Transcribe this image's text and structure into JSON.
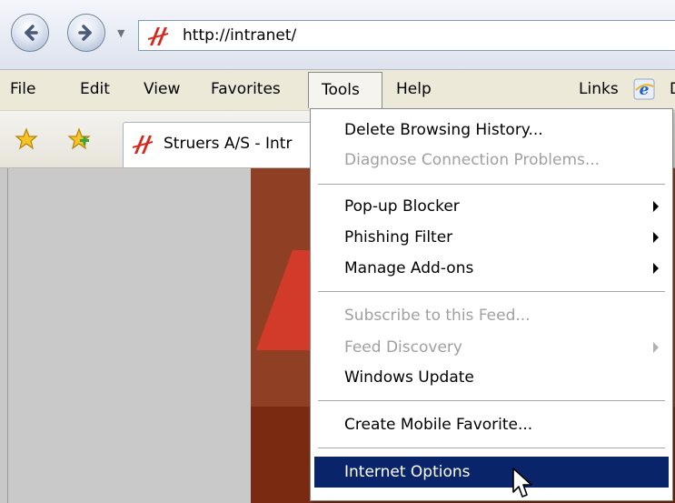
{
  "address": {
    "url": "http://intranet/"
  },
  "menubar": {
    "items": [
      {
        "label": "File"
      },
      {
        "label": "Edit"
      },
      {
        "label": "View"
      },
      {
        "label": "Favorites"
      },
      {
        "label": "Tools"
      },
      {
        "label": "Help"
      }
    ],
    "links_label": "Links",
    "links_cut": "D"
  },
  "tab": {
    "title": "Struers A/S - Intr"
  },
  "tools_menu": {
    "items": [
      {
        "label": "Delete Browsing History...",
        "enabled": true,
        "submenu": false
      },
      {
        "label": "Diagnose Connection Problems...",
        "enabled": false,
        "submenu": false
      },
      {
        "label": "Pop-up Blocker",
        "enabled": true,
        "submenu": true
      },
      {
        "label": "Phishing Filter",
        "enabled": true,
        "submenu": true
      },
      {
        "label": "Manage Add-ons",
        "enabled": true,
        "submenu": true
      },
      {
        "label": "Subscribe to this Feed...",
        "enabled": false,
        "submenu": false
      },
      {
        "label": "Feed Discovery",
        "enabled": false,
        "submenu": true
      },
      {
        "label": "Windows Update",
        "enabled": true,
        "submenu": false
      },
      {
        "label": "Create Mobile Favorite...",
        "enabled": true,
        "submenu": false
      },
      {
        "label": "Internet Options",
        "enabled": true,
        "submenu": false,
        "highlighted": true
      }
    ]
  },
  "colors": {
    "menu_highlight": "#0a246a",
    "brand_red": "#d23b2a",
    "brand_dark": "#8e3f24"
  }
}
